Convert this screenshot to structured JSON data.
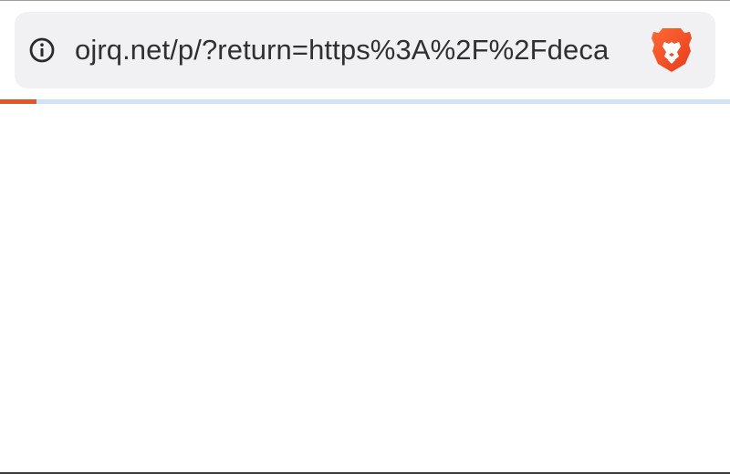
{
  "browser": {
    "url_bar": {
      "url": "ojrq.net/p/?return=https%3A%2F%2Fdeca",
      "site_info_icon": "info-circle-icon",
      "shields_icon": "brave-lion-icon"
    },
    "loading_progress": 0.05,
    "colors": {
      "url_bar_bg": "#f1f1f3",
      "progress_fill": "#e2552c",
      "progress_track": "#cfe3f3",
      "brave_orange": "#f0532b"
    }
  }
}
